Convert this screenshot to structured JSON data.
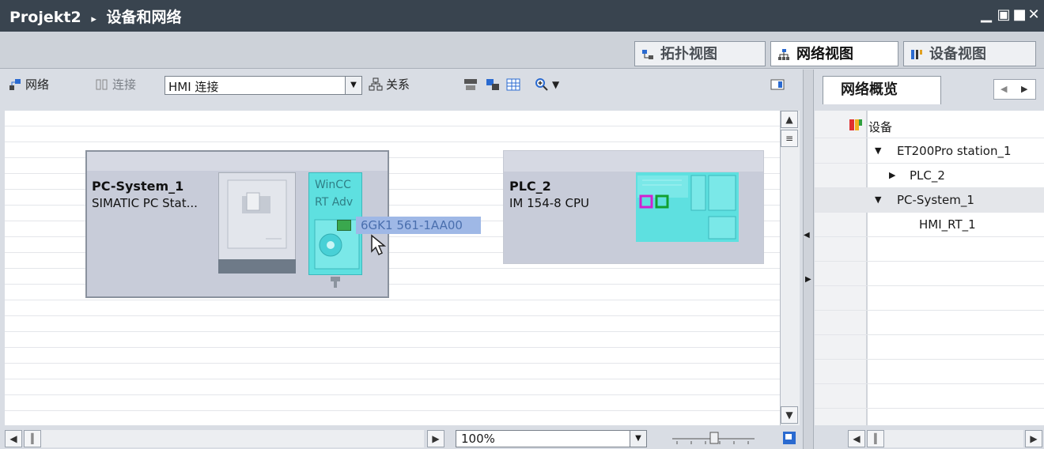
{
  "window": {
    "project": "Projekt2",
    "separator": "▸",
    "title": "设备和网络",
    "controls": [
      "▁",
      "▣",
      "■",
      "✕"
    ]
  },
  "view_tabs": {
    "topology": "拓扑视图",
    "network": "网络视图",
    "device": "设备视图",
    "active": "network"
  },
  "toolbar": {
    "network_label": "网络",
    "connection_label": "连接",
    "connection_type": "HMI 连接",
    "relations_label": "关系",
    "zoom_icon": "zoom-in-icon"
  },
  "canvas": {
    "devices": [
      {
        "name": "PC-System_1",
        "type": "SIMATIC PC Stat...",
        "module_line1": "WinCC",
        "module_line2": "RT Adv",
        "tooltip": "6GK1 561-1AA00"
      },
      {
        "name": "PLC_2",
        "type": "IM 154-8 CPU"
      }
    ]
  },
  "bottom": {
    "zoom": "100%"
  },
  "overview": {
    "tab_label": "网络概览",
    "column_header": "设备",
    "tree": [
      {
        "label": "ET200Pro station_1",
        "expander": "▼"
      },
      {
        "label": "PLC_2",
        "expander": "▶"
      },
      {
        "label": "PC-System_1",
        "expander": "▼"
      },
      {
        "label": "HMI_RT_1",
        "expander": ""
      }
    ]
  },
  "colors": {
    "titlebar": "#39444f",
    "device_bg": "#c8ccd9",
    "module_cyan": "#5ee0e0",
    "selection": "#9fb8e6"
  }
}
